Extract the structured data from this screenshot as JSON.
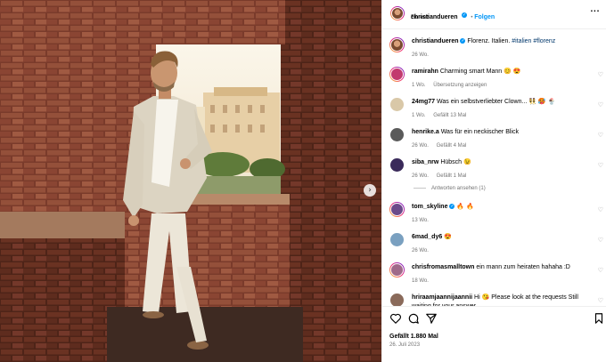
{
  "post": {
    "author": "christiandueren",
    "follow_label": "Folgen",
    "location": "Florenz",
    "caption": "Florenz. Italien.",
    "hashtags": "#italien #florenz",
    "caption_age": "26 Wo.",
    "likes": "Gefällt 1.880 Mal",
    "date": "26. Juli 2023"
  },
  "comments": [
    {
      "user": "ramirahn",
      "text": "Charming smart Mann 😊 😍",
      "age": "1 Wo.",
      "extra": "Übersetzung anzeigen",
      "avatar_color": "#c23a6e"
    },
    {
      "user": "24mg77",
      "text": "Was ein selbstverliebter Clown... 👯 🥵 🍨",
      "age": "1 Wo.",
      "extra": "Gefällt 13 Mal",
      "avatar_color": "#d9c8a8"
    },
    {
      "user": "henrike.a",
      "text": "Was für ein neckischer Blick",
      "age": "26 Wo.",
      "extra": "Gefällt 4 Mal",
      "avatar_color": "#5a5a5a"
    },
    {
      "user": "siba_nrw",
      "text": "Hübsch 😉",
      "age": "26 Wo.",
      "extra": "Gefällt 1 Mal",
      "avatar_color": "#3a2a5a",
      "replies": "Antworten ansehen (1)"
    },
    {
      "user": "tom_skyline",
      "text": "🔥 🔥",
      "age": "13 Wo.",
      "extra": "",
      "avatar_color": "#6b4a8a",
      "verified": true
    },
    {
      "user": "6mad_dy6",
      "text": "😍",
      "age": "26 Wo.",
      "extra": "",
      "avatar_color": "#7aa0c0"
    },
    {
      "user": "chrisfromasmalltown",
      "text": "ein mann zum heiraten hahaha :D",
      "age": "18 Wo.",
      "extra": "",
      "avatar_color": "#a06a8a"
    },
    {
      "user": "hriraamjaannijaannii",
      "text": "Hi 😘 Please look at the requests Still waiting for your answer",
      "age": "",
      "extra": "",
      "avatar_color": "#8a6a5a"
    }
  ],
  "icons": {
    "more": "more-horizontal-icon",
    "heart": "heart-icon",
    "comment": "comment-icon",
    "share": "share-icon",
    "save": "bookmark-icon",
    "next": "chevron-right-icon"
  },
  "colors": {
    "accent": "#0095f6",
    "link": "#00376b",
    "muted": "#737373"
  }
}
